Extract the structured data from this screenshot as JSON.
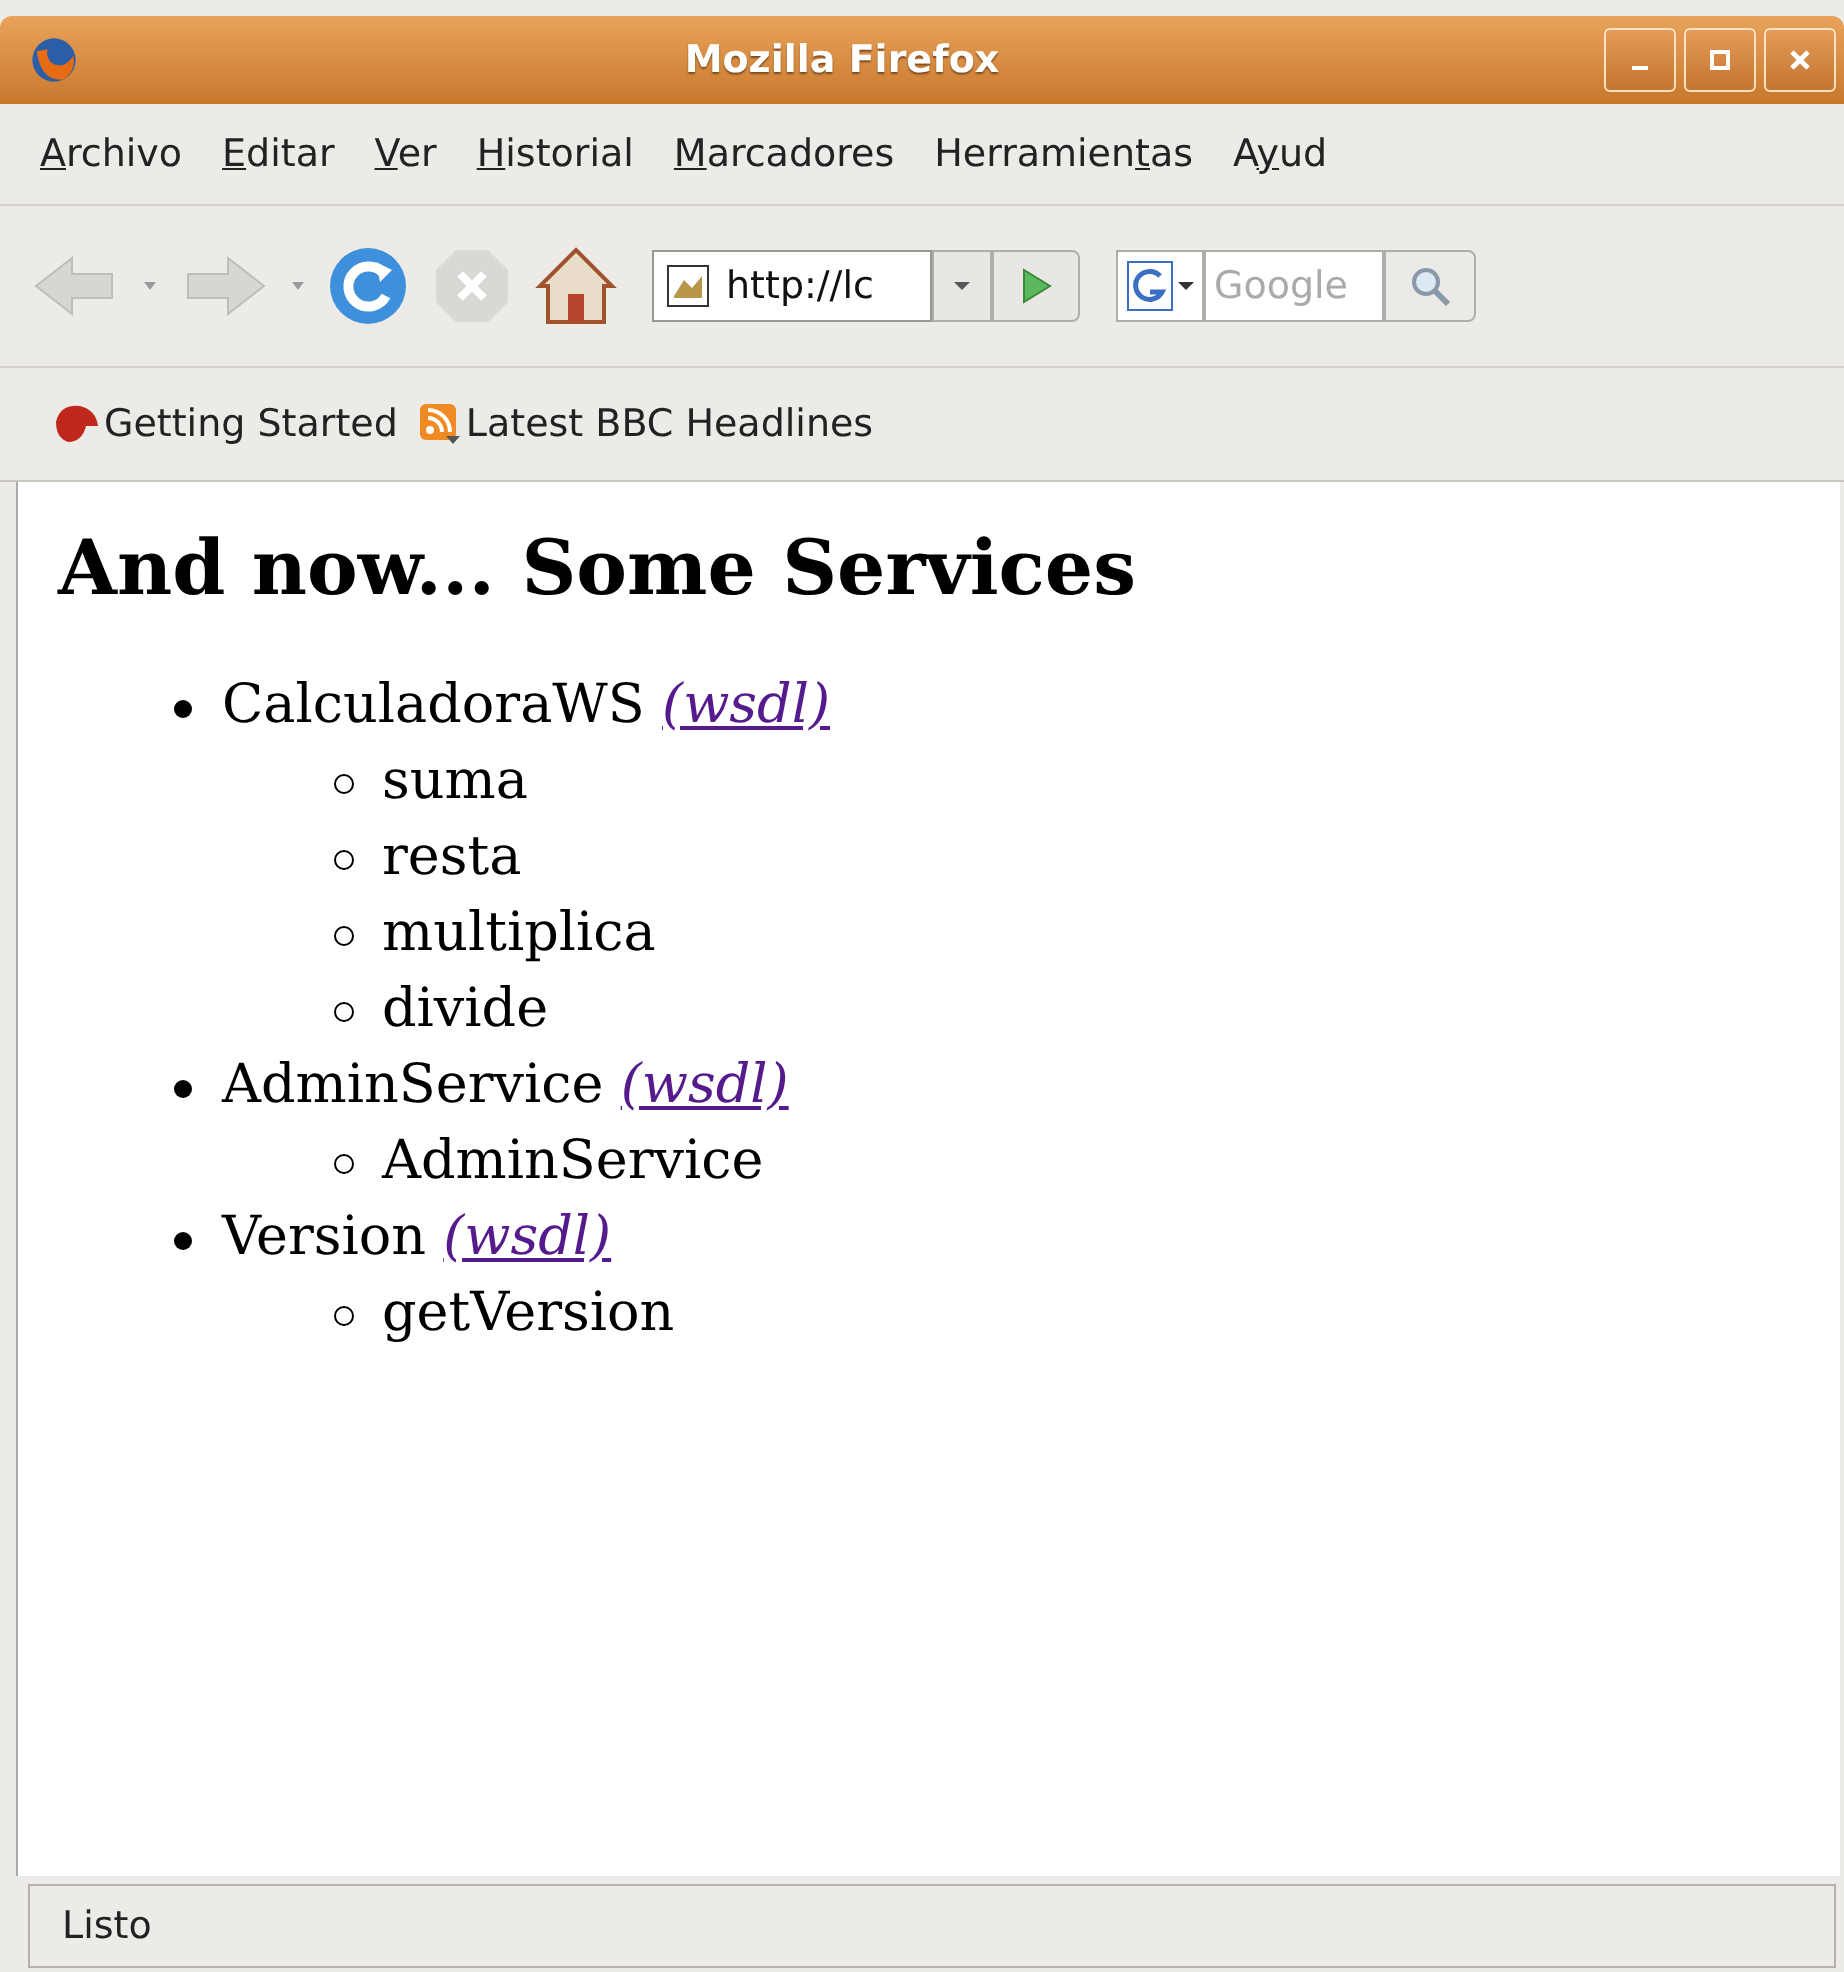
{
  "window": {
    "title": "Mozilla Firefox"
  },
  "menu": [
    {
      "key": "A",
      "post": "rchivo"
    },
    {
      "key": "E",
      "post": "ditar"
    },
    {
      "key": "V",
      "post": "er"
    },
    {
      "key": "H",
      "post": "istorial"
    },
    {
      "key": "M",
      "post": "arcadores"
    },
    {
      "pre": "Herramien",
      "key": "t",
      "post": "as"
    },
    {
      "pre": "A",
      "key": "y",
      "post": "ud"
    }
  ],
  "toolbar": {
    "url": "http://lc",
    "search_placeholder": "Google"
  },
  "bookmarks": [
    {
      "kind": "getting-started",
      "label": "Getting Started"
    },
    {
      "kind": "feed",
      "label": "Latest BBC Headlines"
    }
  ],
  "page": {
    "heading": "And now... Some Services",
    "services": [
      {
        "name": "CalculadoraWS",
        "link": "(wsdl)",
        "operations": [
          "suma",
          "resta",
          "multiplica",
          "divide"
        ]
      },
      {
        "name": "AdminService",
        "link": "(wsdl)",
        "operations": [
          "AdminService"
        ]
      },
      {
        "name": "Version",
        "link": "(wsdl)",
        "operations": [
          "getVersion"
        ]
      }
    ]
  },
  "status_bar": "Listo"
}
